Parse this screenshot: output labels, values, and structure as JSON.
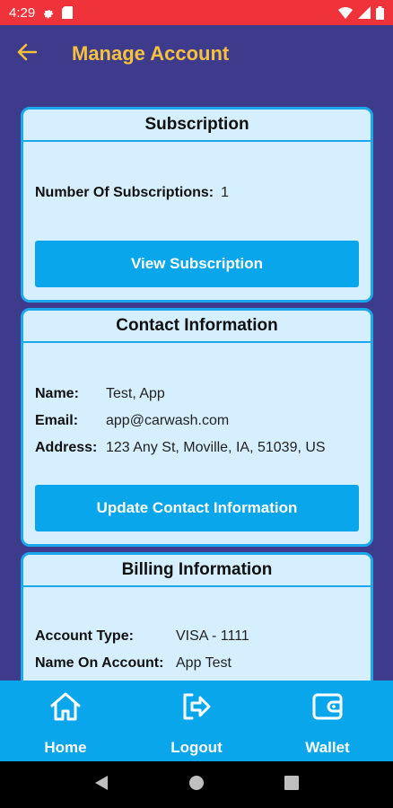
{
  "status": {
    "time": "4:29"
  },
  "header": {
    "title": "Manage Account"
  },
  "subscription": {
    "title": "Subscription",
    "count_label": "Number Of Subscriptions:",
    "count_value": "1",
    "button": "View Subscription"
  },
  "contact": {
    "title": "Contact Information",
    "name_label": "Name:",
    "name_value": "Test, App",
    "email_label": "Email:",
    "email_value": "app@carwash.com",
    "address_label": "Address:",
    "address_value": "123 Any St, Moville, IA, 51039, US",
    "button": "Update Contact Information"
  },
  "billing": {
    "title": "Billing Information",
    "account_type_label": "Account Type:",
    "account_type_value": "VISA - 1111",
    "name_on_account_label": "Name On Account:",
    "name_on_account_value": "App Test"
  },
  "nav": {
    "home": "Home",
    "logout": "Logout",
    "wallet": "Wallet"
  },
  "icons": [
    "settings-icon",
    "sd-card-icon",
    "wifi-icon",
    "signal-icon",
    "battery-icon",
    "back-arrow-icon",
    "home-icon",
    "logout-icon",
    "wallet-icon",
    "nav-back-icon",
    "nav-home-icon",
    "nav-recents-icon"
  ],
  "colors": {
    "status_bar": "#f0333a",
    "background": "#3f3b8c",
    "title": "#f6c23e",
    "accent": "#0aa6ec",
    "card": "#d6efff"
  }
}
